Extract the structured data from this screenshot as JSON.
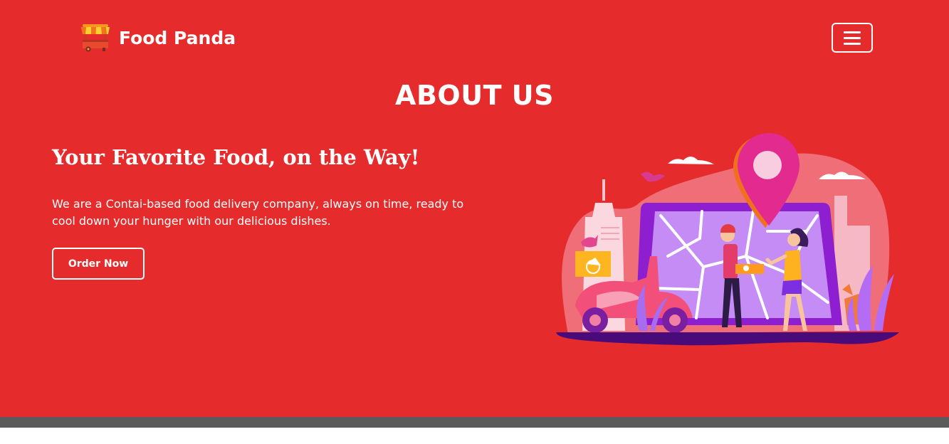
{
  "brand": {
    "name": "Food Panda",
    "logo_icon": "food-stall-icon"
  },
  "nav": {
    "menu_icon": "hamburger-menu-icon"
  },
  "about": {
    "section_title": "ABOUT US",
    "headline": "Your Favorite Food, on the Way!",
    "description": "We are a Contai-based food delivery company, always on time, ready to cool down your hunger with our delicious dishes.",
    "cta_label": "Order Now"
  },
  "colors": {
    "hero_bg": "#e52b2b",
    "bottom_bar": "#5b5b5b",
    "text": "#ffffff"
  }
}
